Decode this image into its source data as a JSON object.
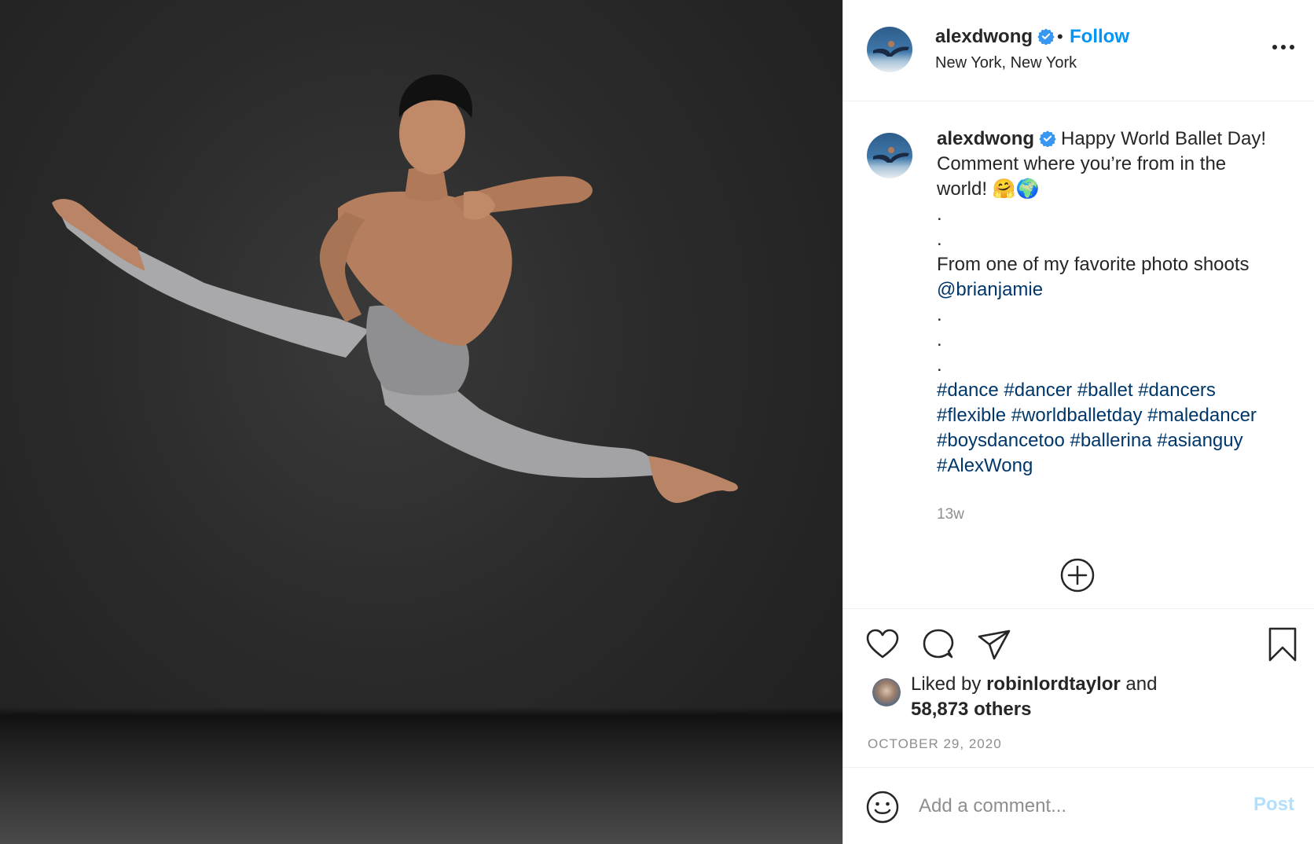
{
  "post": {
    "username": "alexdwong",
    "separator": "•",
    "follow_label": "Follow",
    "location": "New York, New York",
    "verified": true
  },
  "caption": {
    "username": "alexdwong",
    "line1": "Happy World Ballet Day!",
    "line2": "Comment where you’re from in the",
    "line3": "world! 🤗🌍",
    "dot": ".",
    "line_from": "From one of my favorite photo shoots",
    "mention": "@brianjamie",
    "hashtags_line1": "#dance #dancer #ballet #dancers",
    "hashtags_line2": "#flexible #worldballetday #maledancer",
    "hashtags_line3": "#boysdancetoo #ballerina #asianguy",
    "hashtags_line4": "#AlexWong",
    "time": "13w"
  },
  "likes": {
    "prefix": "Liked by",
    "user": "robinlordtaylor",
    "and": "and",
    "count": "58,873 others"
  },
  "date": "OCTOBER 29, 2020",
  "comment": {
    "placeholder": "Add a comment...",
    "post_label": "Post"
  },
  "icons": {
    "verified": "verified-badge-icon",
    "more": "more-options-icon",
    "load_more": "plus-circle-icon",
    "like": "heart-icon",
    "comment": "comment-icon",
    "share": "paper-plane-icon",
    "save": "bookmark-icon",
    "emoji": "smiley-icon"
  },
  "colors": {
    "link_blue": "#0095f6",
    "hashtag": "#00376b",
    "muted": "#8e8e8e",
    "verified_blue": "#3897f0"
  }
}
